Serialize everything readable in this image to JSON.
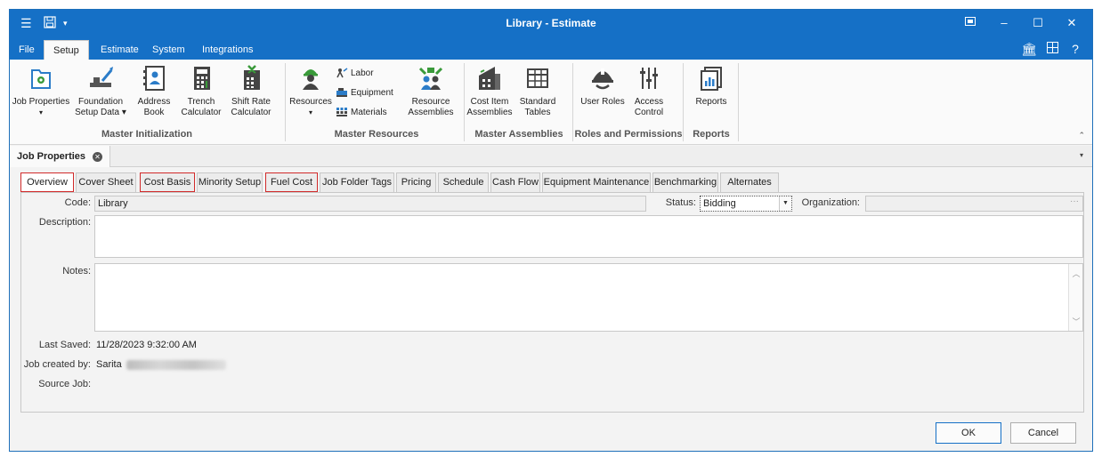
{
  "window": {
    "title": "Library - Estimate"
  },
  "menu_tabs": [
    "File",
    "Setup",
    "Estimate",
    "System",
    "Integrations"
  ],
  "ribbon": {
    "job_properties": "Job Properties",
    "foundation_setup": "Foundation\nSetup Data ▾",
    "foundation_line1": "Foundation",
    "foundation_line2": "Setup Data ▾",
    "address_line1": "Address",
    "address_line2": "Book",
    "trench_line1": "Trench",
    "trench_line2": "Calculator",
    "shift_line1": "Shift Rate",
    "shift_line2": "Calculator",
    "group_master_init": "Master Initialization",
    "resources": "Resources",
    "labor": "Labor",
    "equipment": "Equipment",
    "materials": "Materials",
    "res_asm_line1": "Resource",
    "res_asm_line2": "Assemblies",
    "group_master_resources": "Master Resources",
    "cost_item_line1": "Cost Item",
    "cost_item_line2": "Assemblies",
    "std_tables_line1": "Standard",
    "std_tables_line2": "Tables",
    "group_master_assemblies": "Master Assemblies",
    "user_roles": "User Roles",
    "access_line1": "Access",
    "access_line2": "Control",
    "group_roles": "Roles and Permissions",
    "reports": "Reports",
    "group_reports": "Reports"
  },
  "document_tab": {
    "label": "Job Properties"
  },
  "sub_tabs": [
    "Overview",
    "Cover Sheet",
    "Cost Basis",
    "Minority Setup",
    "Fuel Cost",
    "Job Folder Tags",
    "Pricing",
    "Schedule",
    "Cash Flow",
    "Equipment Maintenance",
    "Benchmarking",
    "Alternates"
  ],
  "form": {
    "code_label": "Code:",
    "code_value": "Library",
    "status_label": "Status:",
    "status_value": "Bidding",
    "organization_label": "Organization:",
    "organization_value": "",
    "description_label": "Description:",
    "notes_label": "Notes:",
    "last_saved_label": "Last Saved:",
    "last_saved_value": "11/28/2023 9:32:00 AM",
    "created_by_label": "Job created by:",
    "created_by_value": "Sarita",
    "source_job_label": "Source Job:",
    "source_job_value": ""
  },
  "buttons": {
    "ok": "OK",
    "cancel": "Cancel"
  },
  "colors": {
    "accent": "#1570c6",
    "highlight": "#d12a2a"
  }
}
